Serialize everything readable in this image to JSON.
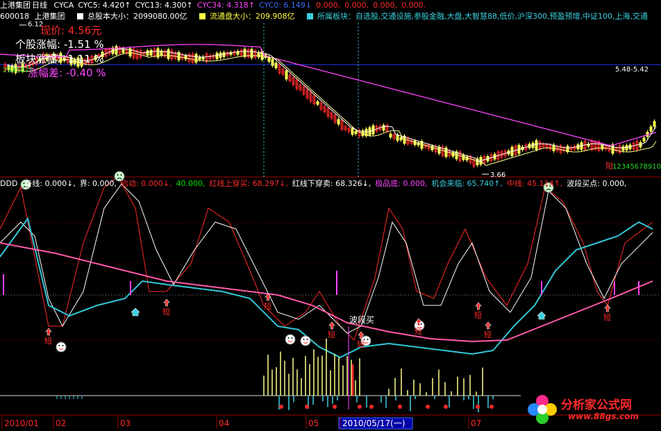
{
  "header": {
    "stock": "上港集团",
    "period": "日线",
    "items": [
      {
        "label": "CYCA",
        "color": "#ffffff"
      },
      {
        "label": "CYC5: 4.420↑",
        "color": "#ffffff"
      },
      {
        "label": "CYC13: 4.300↑",
        "color": "#ffffff"
      },
      {
        "label": "CYC34: 4.318↑",
        "color": "#ff44ff"
      },
      {
        "label": "CYC0: 6.149↓",
        "color": "#3b6cff"
      },
      {
        "label": "0.000,",
        "color": "#ff2a2a"
      },
      {
        "label": "0.000,",
        "color": "#ff2a2a"
      },
      {
        "label": "0.000,",
        "color": "#ff2a2a"
      },
      {
        "label": "0.000.",
        "color": "#ff2a2a"
      }
    ]
  },
  "info_line": {
    "code": "600018",
    "name": "上港集团",
    "total_cap": "总股本大小：2099080.00亿",
    "float_cap": "流通盘大小：209.908亿",
    "sector": "所属板块：自选股,交通设施,参股金融,大盘,大智慧88,低价,沪深300,预盈预增,中证100,上海,交通"
  },
  "overlay": {
    "price": "现价: 4.56元",
    "stock_change": "个股涨幅: -1.51 %",
    "sector_change": "板块涨幅: -1.11 %",
    "diff": "涨幅差: -0.40 %",
    "left_numbers": "2345678",
    "low_label": "3.66",
    "high_label": "6.12",
    "right_label": "12345678910",
    "right_label_prefix": "阳",
    "range_label": "5.48-5.42"
  },
  "indicator": {
    "name": "DDD",
    "items": [
      {
        "label": "备线: 0.000↓,",
        "color": "#ffffff"
      },
      {
        "label": "界: 0.000,",
        "color": "#ffffff"
      },
      {
        "label": "启动: 0.000↓,",
        "color": "#ff2a2a"
      },
      {
        "label": "40.000,",
        "color": "#00dd00"
      },
      {
        "label": "红线上穿买: 68.297↓,",
        "color": "#ff2a2a"
      },
      {
        "label": "红线下穿卖: 68.326↓,",
        "color": "#ffffff"
      },
      {
        "label": "极品底: 0.000,",
        "color": "#ff44ff"
      },
      {
        "label": "机会来临: 65.740↑,",
        "color": "#3ad0e0"
      },
      {
        "label": "中线: 45.114↑,",
        "color": "#ff2a2a"
      },
      {
        "label": "波段买点: 0.000,",
        "color": "#ffffff"
      }
    ],
    "annotation": "波段买",
    "short_label": "短"
  },
  "axis": {
    "labels": [
      "2010/01",
      "02",
      "03",
      "04",
      "05",
      "2010/05/17(一)",
      "07"
    ]
  },
  "watermark": {
    "title": "分析家公式网",
    "url": "www.88gs.com"
  },
  "chart_data": {
    "type": "candlestick",
    "price_range": [
      3.66,
      6.12
    ],
    "price_reference_line": 5.45,
    "indicator_reference_levels": [
      0,
      40,
      100
    ],
    "price_series": [
      {
        "name": "CYC5",
        "value": 4.42
      },
      {
        "name": "CYC13",
        "value": 4.3
      },
      {
        "name": "CYC34",
        "value": 4.318
      },
      {
        "name": "CYC0",
        "value": 6.149
      }
    ],
    "indicator_series": [
      {
        "name": "红线上穿买",
        "value": 68.297
      },
      {
        "name": "红线下穿卖",
        "value": 68.326
      },
      {
        "name": "机会来临",
        "value": 65.74
      },
      {
        "name": "中线",
        "value": 45.114
      }
    ]
  }
}
